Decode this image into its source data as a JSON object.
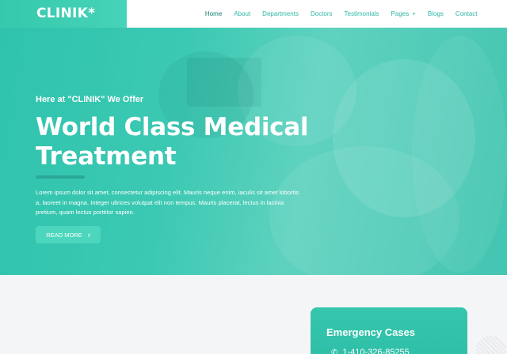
{
  "brand": {
    "logo": "CLINIK*"
  },
  "nav": {
    "items": [
      {
        "label": "Home",
        "active": true
      },
      {
        "label": "About"
      },
      {
        "label": "Departments"
      },
      {
        "label": "Doctors"
      },
      {
        "label": "Testimonials"
      },
      {
        "label": "Pages",
        "plus": "+"
      },
      {
        "label": "Blogs"
      },
      {
        "label": "Contact"
      }
    ]
  },
  "hero": {
    "subtitle": "Here at \"CLINIK\" We Offer",
    "title_line1": "World Class Medical",
    "title_line2": "Treatment",
    "paragraph": "Lorem ipsum dolor sit amet, consectetur adipiscing elit. Mauris neque enim, iaculis sit amet lobortis a, laoreet in magna. Integer ultrices volutpat elit non tempus. Mauris placerat, lectus in lacinia pretium, quam lectus porttitor sapien.",
    "cta_label": "READ MORE",
    "cta_icon": "chevron-right-icon"
  },
  "emergency": {
    "title": "Emergency Cases",
    "phone": "1-410-326-85255",
    "phone_icon": "phone-icon"
  },
  "colors": {
    "brand": "#35c9ad",
    "nav_text": "#2fb8a6",
    "nav_active": "#0f7f73",
    "button": "#4dd6be"
  }
}
